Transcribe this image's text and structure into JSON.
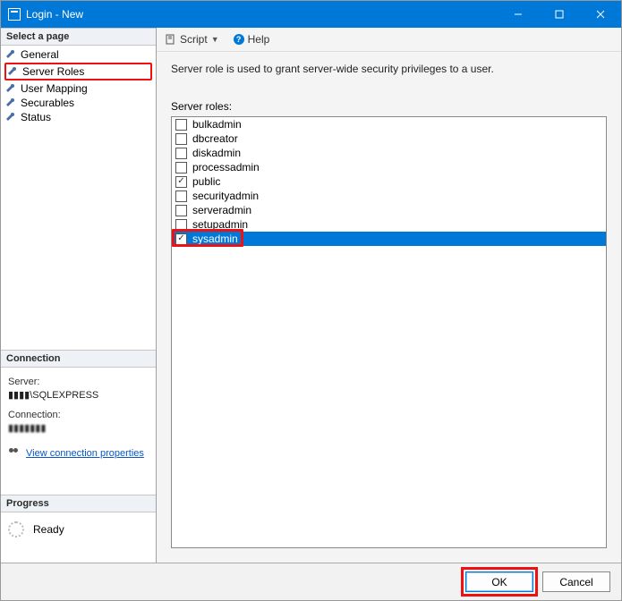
{
  "window": {
    "title": "Login - New"
  },
  "sidebar": {
    "select_header": "Select a page",
    "pages": [
      {
        "label": "General"
      },
      {
        "label": "Server Roles"
      },
      {
        "label": "User Mapping"
      },
      {
        "label": "Securables"
      },
      {
        "label": "Status"
      }
    ],
    "connection_header": "Connection",
    "server_label": "Server:",
    "server_value": "▮▮▮▮\\SQLEXPRESS",
    "connection_label": "Connection:",
    "connection_value": "▮▮▮▮▮▮▮",
    "view_props": "View connection properties",
    "progress_header": "Progress",
    "progress_status": "Ready"
  },
  "toolbar": {
    "script": "Script",
    "help": "Help"
  },
  "main": {
    "description": "Server role is used to grant server-wide security privileges to a user.",
    "roles_label": "Server roles:",
    "roles": [
      {
        "label": "bulkadmin",
        "checked": false,
        "selected": false
      },
      {
        "label": "dbcreator",
        "checked": false,
        "selected": false
      },
      {
        "label": "diskadmin",
        "checked": false,
        "selected": false
      },
      {
        "label": "processadmin",
        "checked": false,
        "selected": false
      },
      {
        "label": "public",
        "checked": true,
        "selected": false
      },
      {
        "label": "securityadmin",
        "checked": false,
        "selected": false
      },
      {
        "label": "serveradmin",
        "checked": false,
        "selected": false
      },
      {
        "label": "setupadmin",
        "checked": false,
        "selected": false
      },
      {
        "label": "sysadmin",
        "checked": true,
        "selected": true
      }
    ]
  },
  "footer": {
    "ok": "OK",
    "cancel": "Cancel"
  }
}
